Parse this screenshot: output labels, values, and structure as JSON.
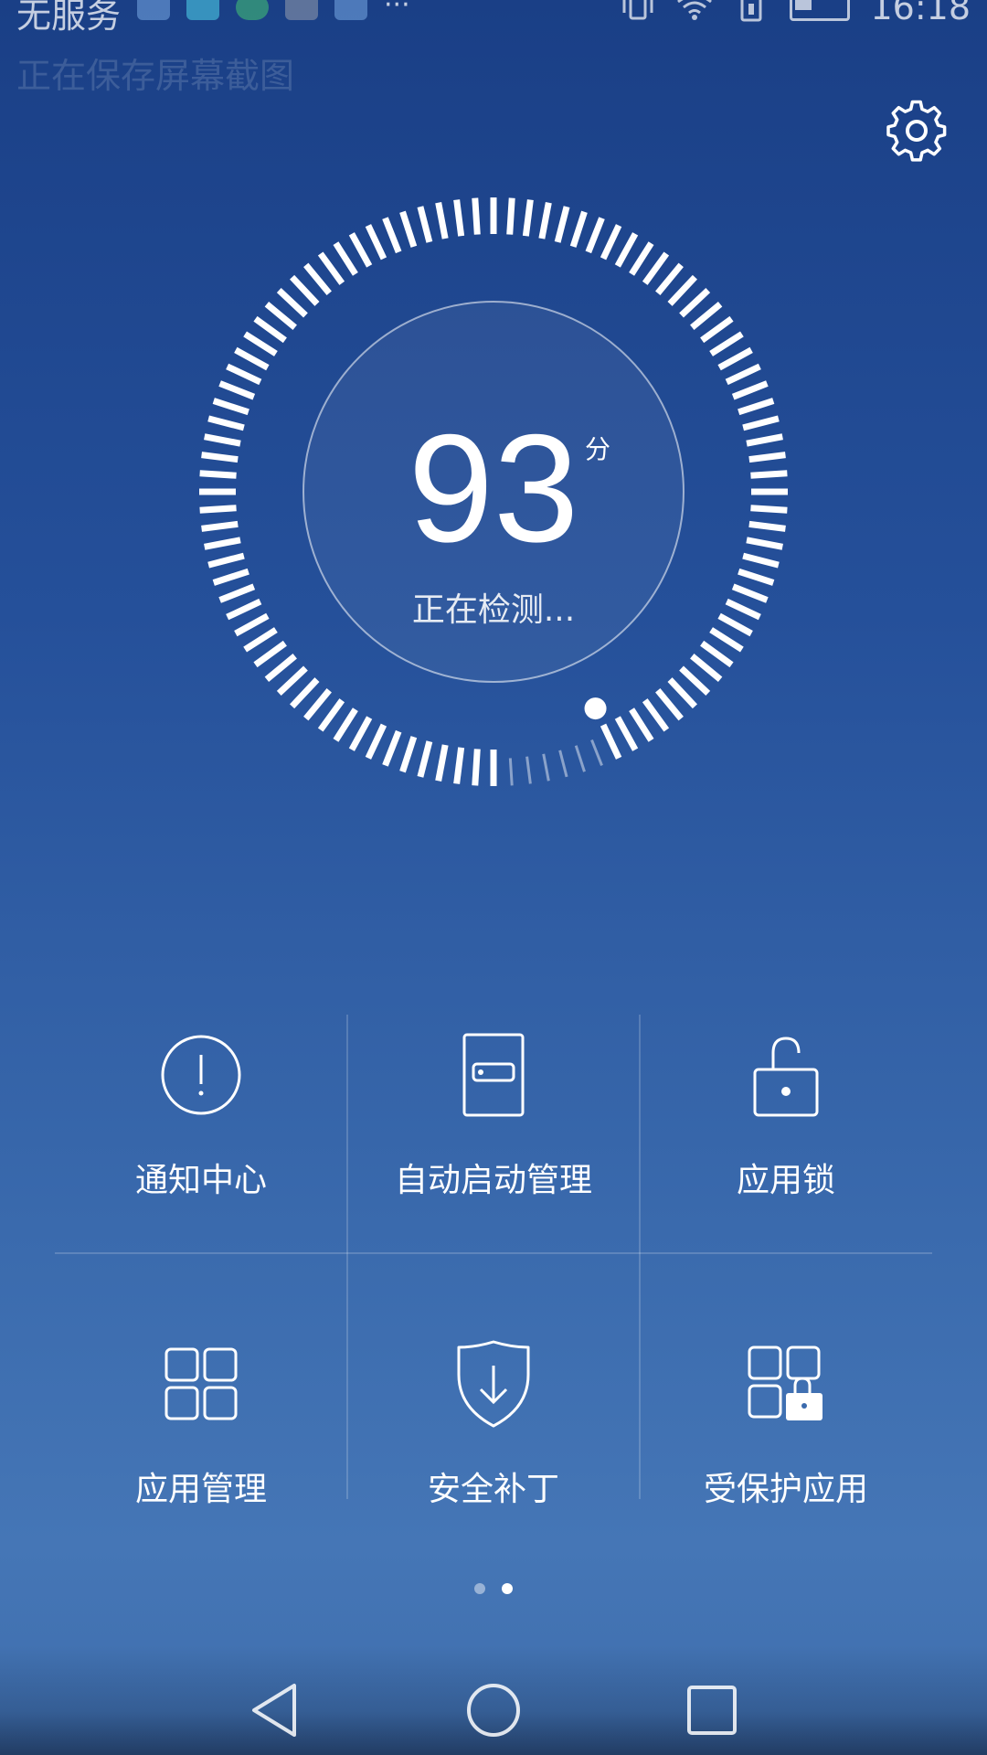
{
  "status_bar": {
    "carrier": "无服务",
    "time": "16:18",
    "notification_ghost": "正在保存屏幕截图"
  },
  "dial": {
    "score": "93",
    "unit": "分",
    "status": "正在检测...",
    "progress_fraction": 0.93
  },
  "grid": {
    "tiles": [
      {
        "label": "通知中心",
        "icon": "alert-circle-icon"
      },
      {
        "label": "自动启动管理",
        "icon": "startup-card-icon"
      },
      {
        "label": "应用锁",
        "icon": "unlock-icon"
      },
      {
        "label": "应用管理",
        "icon": "app-grid-icon"
      },
      {
        "label": "安全补丁",
        "icon": "shield-download-icon"
      },
      {
        "label": "受保护应用",
        "icon": "protected-apps-icon"
      }
    ]
  },
  "pager": {
    "count": 2,
    "active": 1
  },
  "colors": {
    "background_top": "#1a3f86",
    "background_bottom": "#4576b6",
    "foreground": "#ffffff"
  }
}
